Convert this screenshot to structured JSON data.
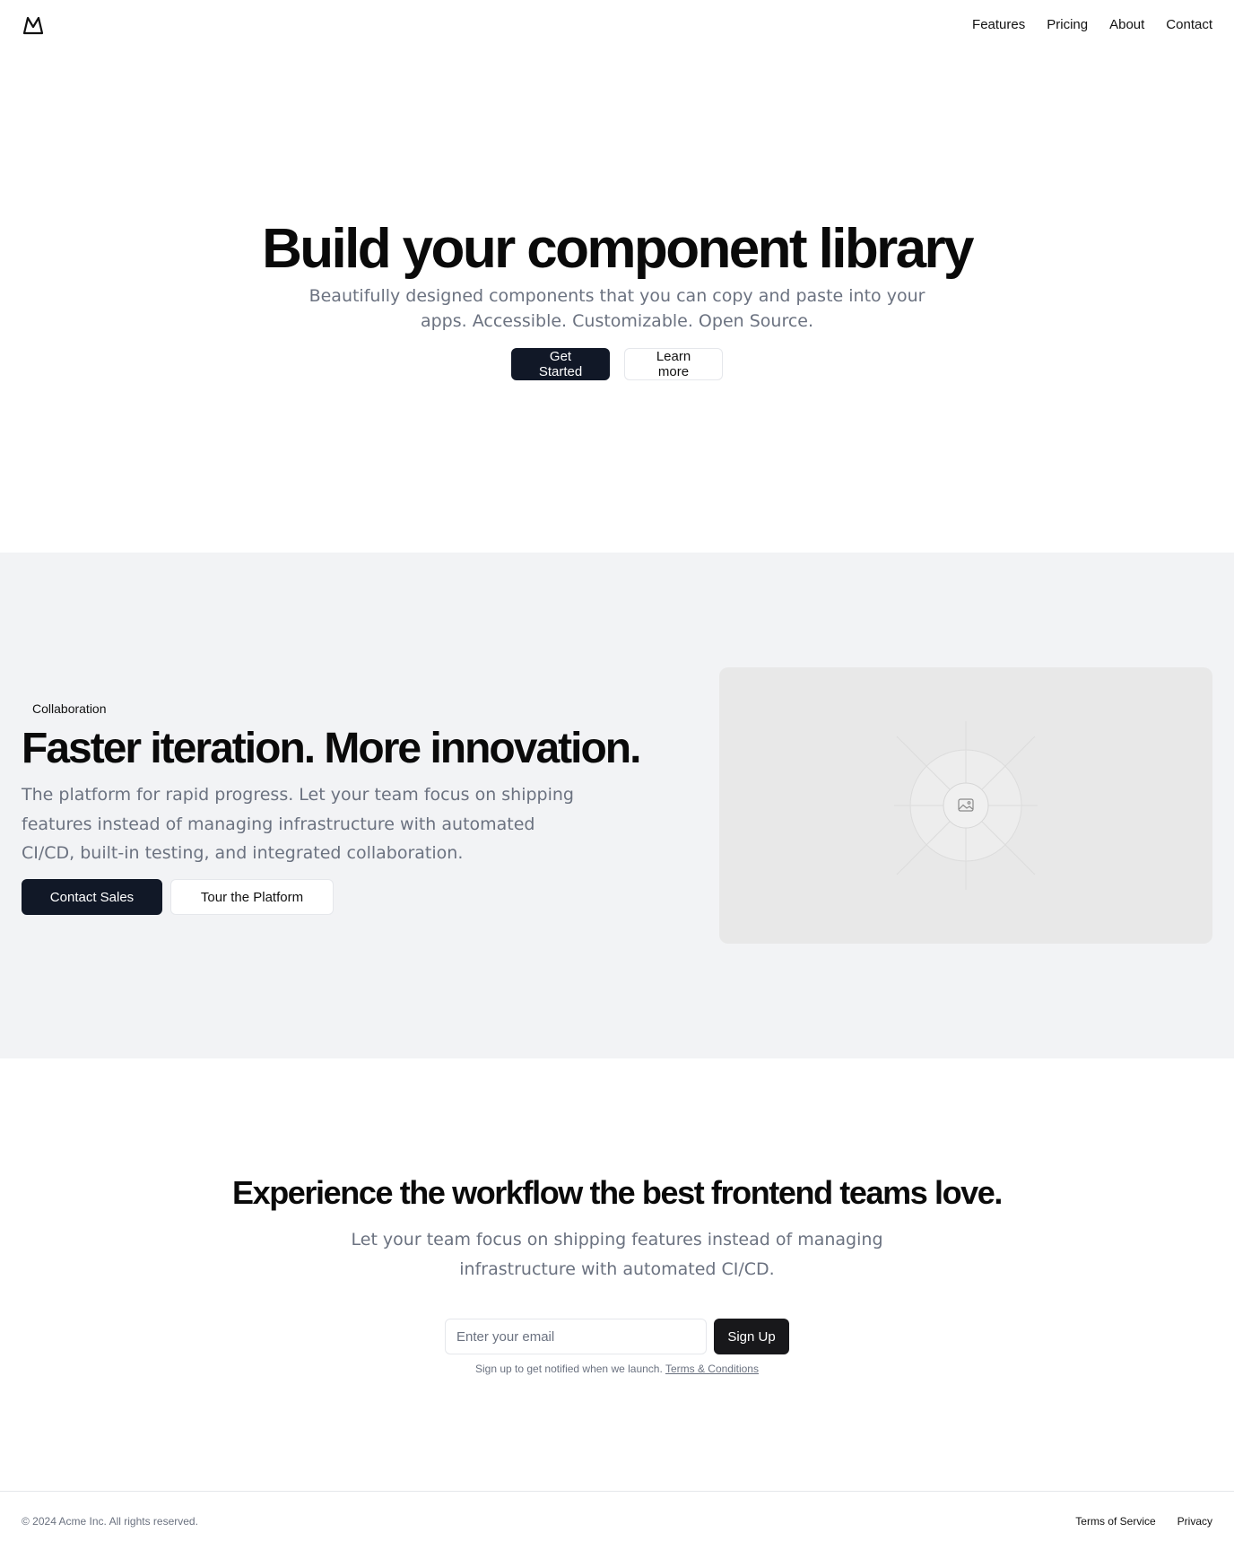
{
  "header": {
    "logo_icon": "mountain-icon",
    "nav": [
      {
        "label": "Features"
      },
      {
        "label": "Pricing"
      },
      {
        "label": "About"
      },
      {
        "label": "Contact"
      }
    ]
  },
  "hero": {
    "title": "Build your component library",
    "subtitle": "Beautifully designed components that you can copy and paste into your apps. Accessible. Customizable. Open Source.",
    "primary_button": "Get Started",
    "secondary_button": "Learn more"
  },
  "feature": {
    "badge": "Collaboration",
    "title": "Faster iteration. More innovation.",
    "subtitle": "The platform for rapid progress. Let your team focus on shipping features instead of managing infrastructure with automated CI/CD, built-in testing, and integrated collaboration.",
    "primary_button": "Contact Sales",
    "secondary_button": "Tour the Platform",
    "image_icon": "image-placeholder-icon"
  },
  "cta": {
    "title": "Experience the workflow the best frontend teams love.",
    "subtitle": "Let your team focus on shipping features instead of managing infrastructure with automated CI/CD.",
    "email_placeholder": "Enter your email",
    "signup_button": "Sign Up",
    "note": "Sign up to get notified when we launch.",
    "terms_link": "Terms & Conditions"
  },
  "footer": {
    "copyright": "© 2024 Acme Inc. All rights reserved.",
    "links": [
      {
        "label": "Terms of Service"
      },
      {
        "label": "Privacy"
      }
    ]
  },
  "colors": {
    "primary_dark": "#111827",
    "muted_text": "#6b7280",
    "section_bg": "#f2f3f5",
    "border": "#e5e7eb"
  }
}
